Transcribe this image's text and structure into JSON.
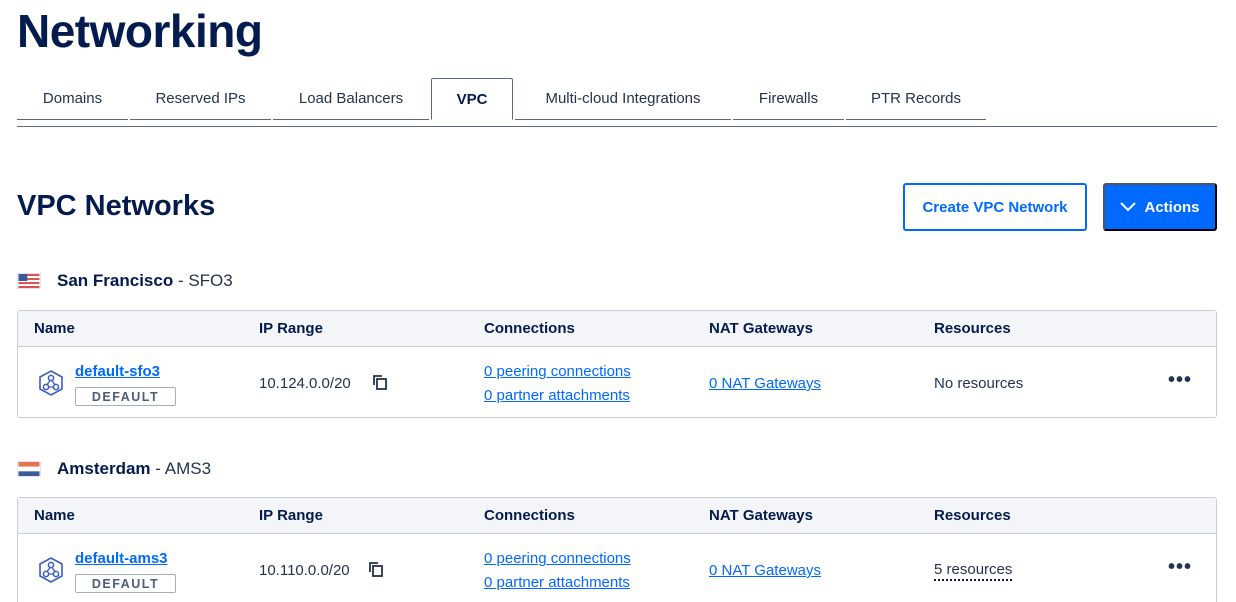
{
  "page": {
    "title": "Networking"
  },
  "tabs": [
    {
      "label": "Domains",
      "active": false
    },
    {
      "label": "Reserved IPs",
      "active": false
    },
    {
      "label": "Load Balancers",
      "active": false
    },
    {
      "label": "VPC",
      "active": true
    },
    {
      "label": "Multi-cloud Integrations",
      "active": false
    },
    {
      "label": "Firewalls",
      "active": false
    },
    {
      "label": "PTR Records",
      "active": false
    }
  ],
  "section": {
    "title": "VPC Networks",
    "create_button": "Create VPC Network",
    "actions_button": "Actions"
  },
  "columns": [
    "Name",
    "IP Range",
    "Connections",
    "NAT Gateways",
    "Resources"
  ],
  "regions": [
    {
      "city": "San Francisco",
      "code": "- SFO3",
      "flag": "us-flag-icon",
      "rows": [
        {
          "name": "default-sfo3",
          "badge": "DEFAULT",
          "ip_range": "10.124.0.0/20",
          "peering": "0 peering connections",
          "partner": "0 partner attachments",
          "nat": "0 NAT Gateways",
          "resources": "No resources"
        }
      ]
    },
    {
      "city": "Amsterdam",
      "code": "- AMS3",
      "flag": "nl-flag-icon",
      "rows": [
        {
          "name": "default-ams3",
          "badge": "DEFAULT",
          "ip_range": "10.110.0.0/20",
          "peering": "0 peering connections",
          "partner": "0 partner attachments",
          "nat": "0 NAT Gateways",
          "resources": "5 resources"
        }
      ]
    }
  ],
  "more_glyph": "•••",
  "colors": {
    "accent": "#0069ff",
    "text": "#031b4e",
    "header_bg": "#f3f5f9"
  }
}
